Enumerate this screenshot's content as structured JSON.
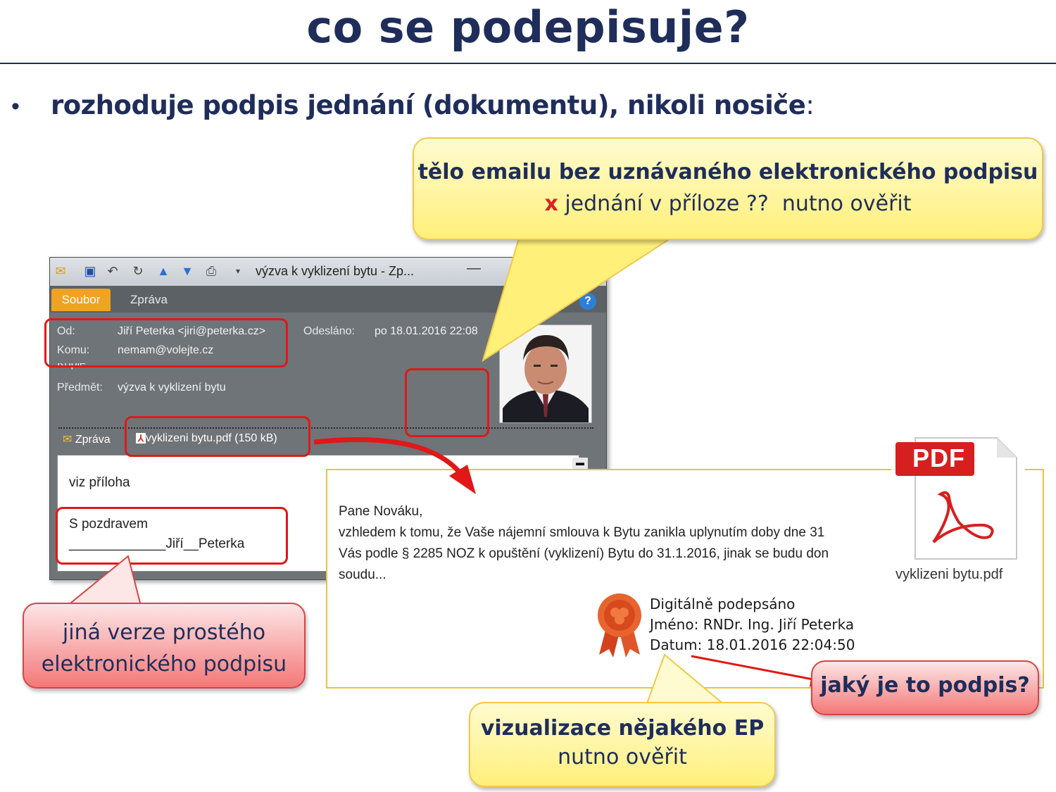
{
  "slide": {
    "title": "co se podepisuje?",
    "bullet": "rozhoduje podpis jednání (dokumentu), nikoli nosiče",
    "bullet_colon": ":"
  },
  "callouts": {
    "top_line1": "tělo emailu bez uznávaného elektronického podpisu",
    "top_x": "x",
    "top_line2_a": " jednání v příloze ??",
    "top_line2_b": "nutno ověřit",
    "left_line1": "jiná verze prostého",
    "left_line2": "elektronického podpisu",
    "right": "jaký je to podpis?",
    "bottom_line1": "vizualizace nějakého EP",
    "bottom_line2": "nutno ověřit"
  },
  "outlook": {
    "window_title": "výzva k vyklizení bytu  -  Zp...",
    "tabs": [
      "Soubor",
      "Zpráva"
    ],
    "header": {
      "from_label": "Od:",
      "from_value": "Jiří Peterka <jiri@peterka.cz>",
      "to_label": "Komu:",
      "to_value": "nemam@volejte.cz",
      "cc_label": "Kopie:",
      "subject_label": "Předmět:",
      "subject_value": "výzva k vyklizení bytu",
      "sent_label": "Odesláno:",
      "sent_value": "po 18.01.2016 22:08"
    },
    "attachments": {
      "message_tab": "Zpráva",
      "file": "vyklizeni bytu.pdf (150 kB)"
    },
    "body": {
      "text": "viz příloha",
      "signoff": "S pozdravem",
      "signature": "_____________Jiří__Peterka"
    }
  },
  "pdf_preview": {
    "letter_lines": [
      "Pane Nováku,",
      "vzhledem k tomu, že Vaše nájemní smlouva k Bytu zanikla uplynutím doby dne 31",
      "Vás podle § 2285 NOZ k opuštění (vyklizení) Bytu do 31.1.2016, jinak se budu don",
      "soudu..."
    ],
    "signature_lines": [
      "Digitálně podepsáno",
      "Jméno: RNDr. Ing. Jiří Peterka",
      "Datum: 18.01.2016 22:04:50"
    ]
  },
  "pdf_icon": {
    "badge": "PDF",
    "filename": "vyklizeni bytu.pdf"
  },
  "colors": {
    "title_navy": "#1f2d5a",
    "callout_yellow": "#fff07a",
    "callout_red": "#f47878",
    "highlight_red": "#e01818",
    "soubor_orange": "#f0a225"
  }
}
